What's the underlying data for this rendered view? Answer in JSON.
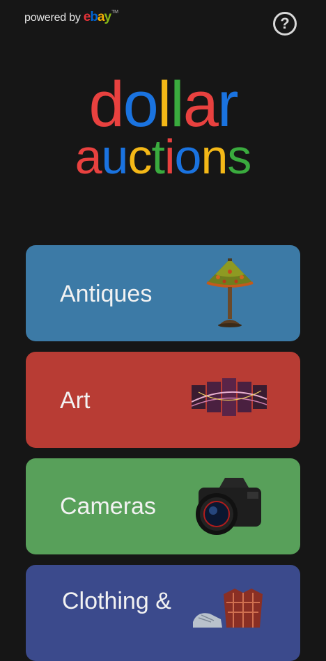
{
  "header": {
    "powered_label": "powered by",
    "ebay_letters": [
      "e",
      "b",
      "a",
      "y"
    ],
    "ebay_tm": "TM",
    "help_glyph": "?",
    "help_icon": "help-circle-icon"
  },
  "logo": {
    "line1": [
      "d",
      "o",
      "l",
      "l",
      "a",
      "r"
    ],
    "line2": [
      "a",
      "u",
      "c",
      "t",
      "i",
      "o",
      "n",
      "s"
    ]
  },
  "colors": {
    "background": "#161616",
    "logo_red": "#e8413f",
    "logo_blue": "#1a73e0",
    "logo_yellow": "#f4b817",
    "logo_green": "#3aab3e",
    "ebay_red": "#e53238",
    "ebay_blue": "#0064d2",
    "ebay_yellow": "#f5af02",
    "ebay_green": "#86b817"
  },
  "categories": [
    {
      "label": "Antiques",
      "color": "#3c7aa6",
      "icon": "tiffany-lamp-icon"
    },
    {
      "label": "Art",
      "color": "#b83c34",
      "icon": "canvas-art-icon"
    },
    {
      "label": "Cameras",
      "color": "#58a05a",
      "icon": "camera-icon"
    },
    {
      "label": "Clothing &",
      "color": "#3b4a8c",
      "icon": "clothing-shoe-icon"
    }
  ]
}
